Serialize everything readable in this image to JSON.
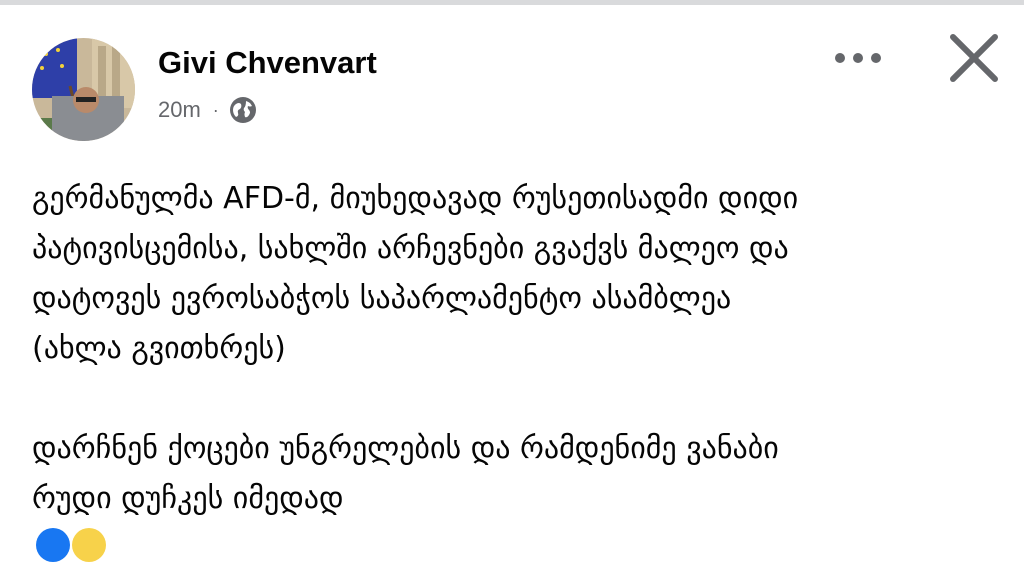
{
  "post": {
    "author_name": "Givi Chvenvart",
    "timestamp": "20m",
    "meta_separator": "·",
    "audience_icon": "globe-icon",
    "paragraphs": [
      [
        "გერმანულმა AFD-მ, მიუხედავად რუსეთისადმი დიდი",
        "პატივისცემისა, სახლში არჩევნები გვაქვს მალეო და",
        "დატოვეს ევროსაბჭოს საპარლამენტო ასამბლეა",
        "(ახლა გვითხრეს)"
      ],
      [
        "დარჩნენ ქოცები უნგრელების და რამდენიმე ვანაბი",
        "რუდი დუჩკეს იმედად"
      ]
    ],
    "reaction_icons": [
      "like-icon",
      "haha-icon"
    ]
  },
  "header": {
    "more_icon": "more-dots-icon",
    "close_icon": "close-icon"
  },
  "colors": {
    "text_primary": "#050505",
    "text_secondary": "#65676b",
    "icon_gray": "#65676b",
    "like_blue": "#1877f2",
    "haha_yellow": "#f7d24a"
  }
}
